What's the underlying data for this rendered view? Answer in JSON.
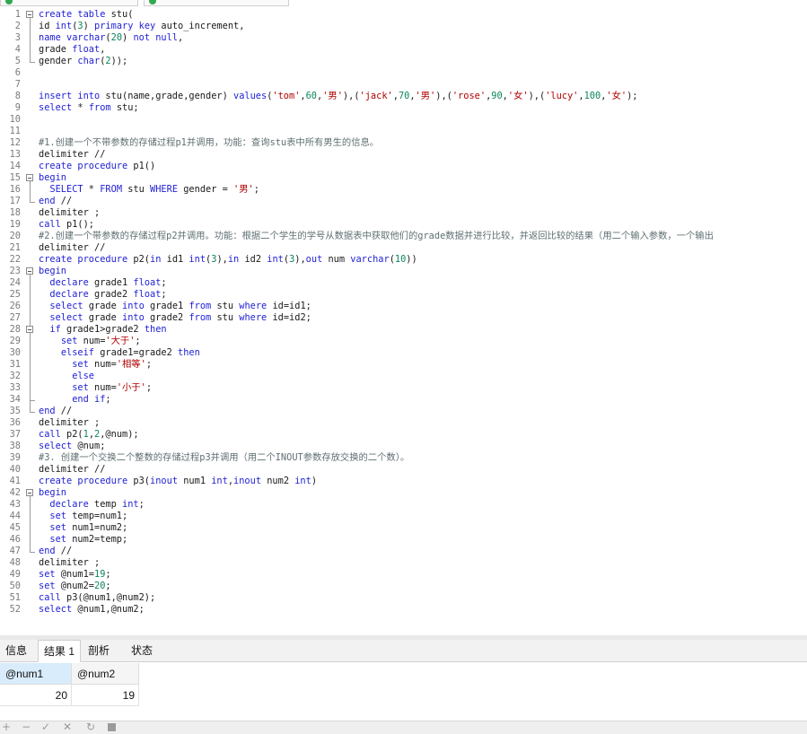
{
  "bottom_tabs": [
    "信息",
    "结果 1",
    "剖析",
    "状态"
  ],
  "result_grid": {
    "columns": [
      "@num1",
      "@num2"
    ],
    "rows": [
      [
        "20",
        "19"
      ]
    ]
  },
  "toolbar_icons": [
    "plus-icon",
    "minus-icon",
    "check-icon",
    "cross-icon",
    "refresh-icon",
    "stop-icon"
  ],
  "colors": {
    "keyword": "#1f1fd6",
    "string": "#b00000",
    "comment": "#5f6f72",
    "number": "#098658"
  },
  "editor_lines": [
    [
      [
        "k",
        "create table"
      ],
      [
        "t",
        " stu("
      ]
    ],
    [
      [
        "t",
        "id "
      ],
      [
        "k",
        "int"
      ],
      [
        "t",
        "("
      ],
      [
        "n",
        "3"
      ],
      [
        "t",
        ") "
      ],
      [
        "k",
        "primary key"
      ],
      [
        "t",
        " auto_increment,"
      ]
    ],
    [
      [
        "k",
        "name"
      ],
      [
        "t",
        " "
      ],
      [
        "k",
        "varchar"
      ],
      [
        "t",
        "("
      ],
      [
        "n",
        "20"
      ],
      [
        "t",
        ") "
      ],
      [
        "k",
        "not null"
      ],
      [
        "t",
        ","
      ]
    ],
    [
      [
        "t",
        "grade "
      ],
      [
        "k",
        "float"
      ],
      [
        "t",
        ","
      ]
    ],
    [
      [
        "t",
        "gender "
      ],
      [
        "k",
        "char"
      ],
      [
        "t",
        "("
      ],
      [
        "n",
        "2"
      ],
      [
        "t",
        "));"
      ]
    ],
    [],
    [],
    [
      [
        "k",
        "insert into"
      ],
      [
        "t",
        " stu(name,grade,gender) "
      ],
      [
        "k",
        "values"
      ],
      [
        "t",
        "("
      ],
      [
        "s",
        "'tom'"
      ],
      [
        "t",
        ","
      ],
      [
        "n",
        "60"
      ],
      [
        "t",
        ","
      ],
      [
        "s",
        "'男'"
      ],
      [
        "t",
        "),("
      ],
      [
        "s",
        "'jack'"
      ],
      [
        "t",
        ","
      ],
      [
        "n",
        "70"
      ],
      [
        "t",
        ","
      ],
      [
        "s",
        "'男'"
      ],
      [
        "t",
        "),("
      ],
      [
        "s",
        "'rose'"
      ],
      [
        "t",
        ","
      ],
      [
        "n",
        "90"
      ],
      [
        "t",
        ","
      ],
      [
        "s",
        "'女'"
      ],
      [
        "t",
        "),("
      ],
      [
        "s",
        "'lucy'"
      ],
      [
        "t",
        ","
      ],
      [
        "n",
        "100"
      ],
      [
        "t",
        ","
      ],
      [
        "s",
        "'女'"
      ],
      [
        "t",
        ");"
      ]
    ],
    [
      [
        "k",
        "select"
      ],
      [
        "t",
        " * "
      ],
      [
        "k",
        "from"
      ],
      [
        "t",
        " stu;"
      ]
    ],
    [],
    [],
    [
      [
        "c",
        "#1.创建一个不带参数的存储过程p1并调用，功能：查询stu表中所有男生的信息。"
      ]
    ],
    [
      [
        "t",
        "delimiter //"
      ]
    ],
    [
      [
        "k",
        "create procedure"
      ],
      [
        "t",
        " p1()"
      ]
    ],
    [
      [
        "k",
        "begin"
      ]
    ],
    [
      [
        "t",
        "  "
      ],
      [
        "k",
        "SELECT"
      ],
      [
        "t",
        " * "
      ],
      [
        "k",
        "FROM"
      ],
      [
        "t",
        " stu "
      ],
      [
        "k",
        "WHERE"
      ],
      [
        "t",
        " gender = "
      ],
      [
        "s",
        "'男'"
      ],
      [
        "t",
        ";"
      ]
    ],
    [
      [
        "k",
        "end"
      ],
      [
        "t",
        " //"
      ]
    ],
    [
      [
        "t",
        "delimiter ;"
      ]
    ],
    [
      [
        "k",
        "call"
      ],
      [
        "t",
        " p1();"
      ]
    ],
    [
      [
        "c",
        "#2.创建一个带参数的存储过程p2并调用。功能：根据二个学生的学号从数据表中获取他们的grade数据并进行比较，并返回比较的结果（用二个输入参数，一个输出"
      ]
    ],
    [
      [
        "t",
        "delimiter //"
      ]
    ],
    [
      [
        "k",
        "create procedure"
      ],
      [
        "t",
        " p2("
      ],
      [
        "k",
        "in"
      ],
      [
        "t",
        " id1 "
      ],
      [
        "k",
        "int"
      ],
      [
        "t",
        "("
      ],
      [
        "n",
        "3"
      ],
      [
        "t"
      ],
      [
        "t",
        "),"
      ],
      [
        "k",
        "in"
      ],
      [
        "t",
        " id2 "
      ],
      [
        "k",
        "int"
      ],
      [
        "t",
        "("
      ],
      [
        "n",
        "3"
      ],
      [
        "t",
        "),"
      ],
      [
        "k",
        "out"
      ],
      [
        "t",
        " num "
      ],
      [
        "k",
        "varchar"
      ],
      [
        "t",
        "("
      ],
      [
        "n",
        "10"
      ],
      [
        "t",
        "))"
      ]
    ],
    [
      [
        "k",
        "begin"
      ]
    ],
    [
      [
        "t",
        "  "
      ],
      [
        "k",
        "declare"
      ],
      [
        "t",
        " grade1 "
      ],
      [
        "k",
        "float"
      ],
      [
        "t",
        ";"
      ]
    ],
    [
      [
        "t",
        "  "
      ],
      [
        "k",
        "declare"
      ],
      [
        "t",
        " grade2 "
      ],
      [
        "k",
        "float"
      ],
      [
        "t",
        ";"
      ]
    ],
    [
      [
        "t",
        "  "
      ],
      [
        "k",
        "select"
      ],
      [
        "t",
        " grade "
      ],
      [
        "k",
        "into"
      ],
      [
        "t",
        " grade1 "
      ],
      [
        "k",
        "from"
      ],
      [
        "t",
        " stu "
      ],
      [
        "k",
        "where"
      ],
      [
        "t",
        " id=id1;"
      ]
    ],
    [
      [
        "t",
        "  "
      ],
      [
        "k",
        "select"
      ],
      [
        "t",
        " grade "
      ],
      [
        "k",
        "into"
      ],
      [
        "t",
        " grade2 "
      ],
      [
        "k",
        "from"
      ],
      [
        "t",
        " stu "
      ],
      [
        "k",
        "where"
      ],
      [
        "t",
        " id=id2;"
      ]
    ],
    [
      [
        "t",
        "  "
      ],
      [
        "k",
        "if"
      ],
      [
        "t",
        " grade1>grade2 "
      ],
      [
        "k",
        "then"
      ]
    ],
    [
      [
        "t",
        "    "
      ],
      [
        "k",
        "set"
      ],
      [
        "t",
        " num="
      ],
      [
        "s",
        "'大于'"
      ],
      [
        "t",
        ";"
      ]
    ],
    [
      [
        "t",
        "    "
      ],
      [
        "k",
        "elseif"
      ],
      [
        "t",
        " grade1=grade2 "
      ],
      [
        "k",
        "then"
      ]
    ],
    [
      [
        "t",
        "      "
      ],
      [
        "k",
        "set"
      ],
      [
        "t",
        " num="
      ],
      [
        "s",
        "'相等'"
      ],
      [
        "t",
        ";"
      ]
    ],
    [
      [
        "t",
        "      "
      ],
      [
        "k",
        "else"
      ]
    ],
    [
      [
        "t",
        "      "
      ],
      [
        "k",
        "set"
      ],
      [
        "t",
        " num="
      ],
      [
        "s",
        "'小于'"
      ],
      [
        "t",
        ";"
      ]
    ],
    [
      [
        "t",
        "      "
      ],
      [
        "k",
        "end if"
      ],
      [
        "t",
        ";"
      ]
    ],
    [
      [
        "k",
        "end"
      ],
      [
        "t",
        " //"
      ]
    ],
    [
      [
        "t",
        "delimiter ;"
      ]
    ],
    [
      [
        "k",
        "call"
      ],
      [
        "t",
        " p2("
      ],
      [
        "n",
        "1"
      ],
      [
        "t",
        ","
      ],
      [
        "n",
        "2"
      ],
      [
        "t",
        ",@num);"
      ]
    ],
    [
      [
        "k",
        "select"
      ],
      [
        "t",
        " @num;"
      ]
    ],
    [
      [
        "c",
        "#3. 创建一个交换二个整数的存储过程p3并调用（用二个INOUT参数存放交换的二个数）。"
      ]
    ],
    [
      [
        "t",
        "delimiter //"
      ]
    ],
    [
      [
        "k",
        "create procedure"
      ],
      [
        "t",
        " p3("
      ],
      [
        "k",
        "inout"
      ],
      [
        "t",
        " num1 "
      ],
      [
        "k",
        "int"
      ],
      [
        "t",
        ","
      ],
      [
        "k",
        "inout"
      ],
      [
        "t",
        " num2 "
      ],
      [
        "k",
        "int"
      ],
      [
        "t",
        ")"
      ]
    ],
    [
      [
        "k",
        "begin"
      ]
    ],
    [
      [
        "t",
        "  "
      ],
      [
        "k",
        "declare"
      ],
      [
        "t",
        " temp "
      ],
      [
        "k",
        "int"
      ],
      [
        "t",
        ";"
      ]
    ],
    [
      [
        "t",
        "  "
      ],
      [
        "k",
        "set"
      ],
      [
        "t",
        " temp=num1;"
      ]
    ],
    [
      [
        "t",
        "  "
      ],
      [
        "k",
        "set"
      ],
      [
        "t",
        " num1=num2;"
      ]
    ],
    [
      [
        "t",
        "  "
      ],
      [
        "k",
        "set"
      ],
      [
        "t",
        " num2=temp;"
      ]
    ],
    [
      [
        "k",
        "end"
      ],
      [
        "t",
        " //"
      ]
    ],
    [
      [
        "t",
        "delimiter ;"
      ]
    ],
    [
      [
        "k",
        "set"
      ],
      [
        "t",
        " @num1="
      ],
      [
        "n",
        "19"
      ],
      [
        "t",
        ";"
      ]
    ],
    [
      [
        "k",
        "set"
      ],
      [
        "t",
        " @num2="
      ],
      [
        "n",
        "20"
      ],
      [
        "t",
        ";"
      ]
    ],
    [
      [
        "k",
        "call"
      ],
      [
        "t",
        " p3(@num1,@num2);"
      ]
    ],
    [
      [
        "k",
        "select"
      ],
      [
        "t",
        " @num1,@num2;"
      ]
    ]
  ]
}
